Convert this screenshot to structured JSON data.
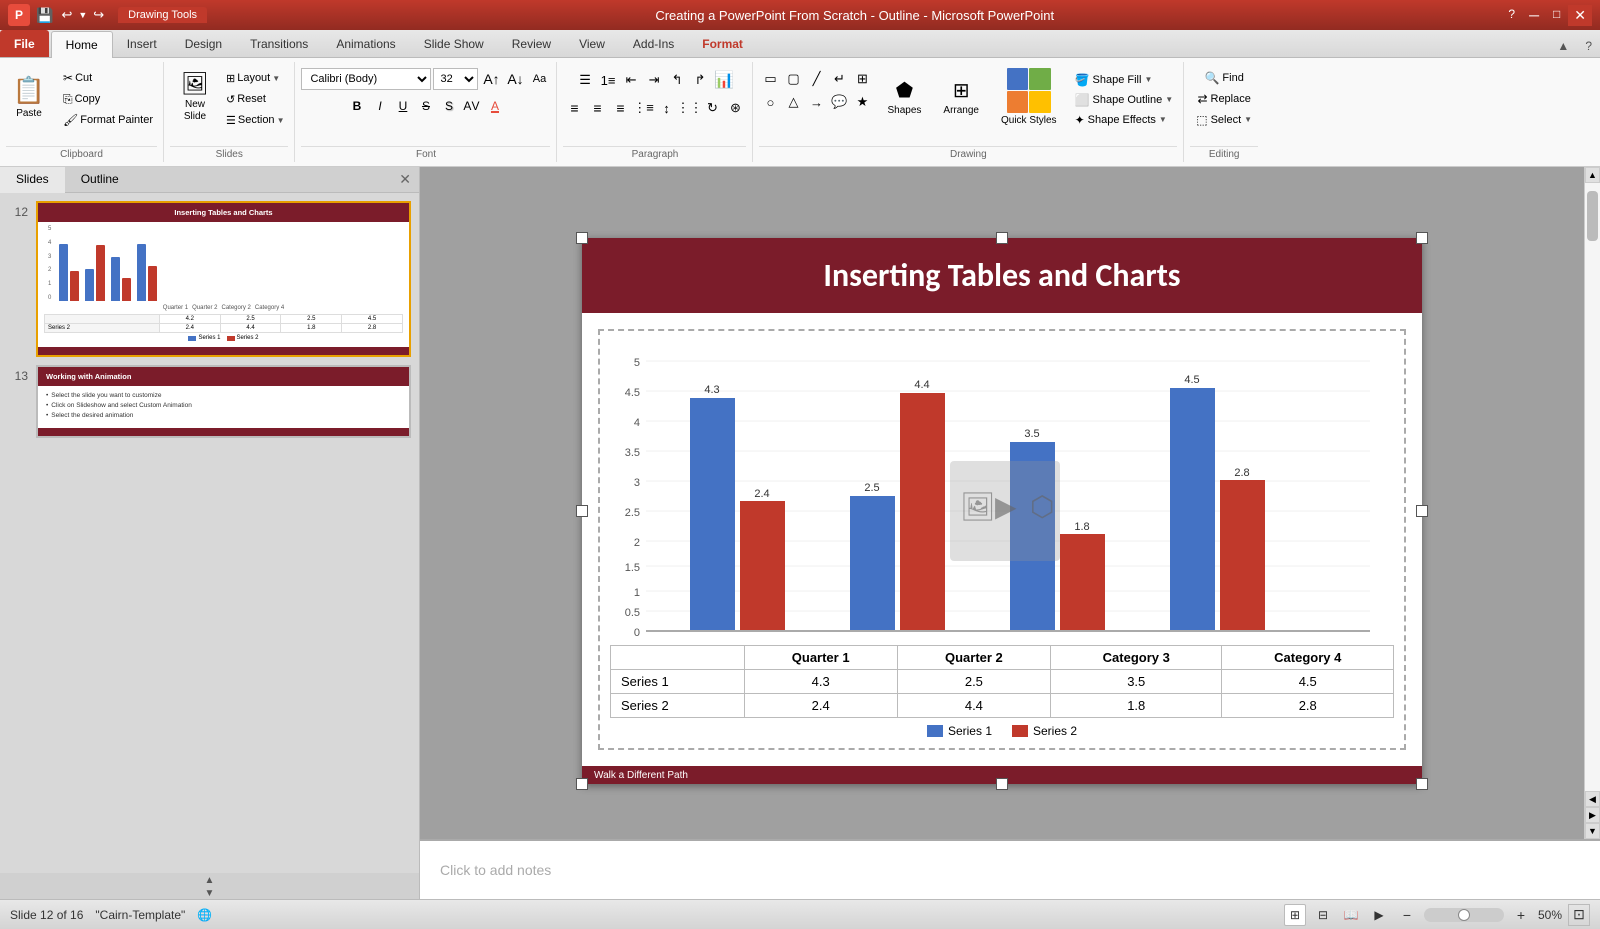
{
  "titleBar": {
    "appName": "P",
    "title": "Creating a PowerPoint From Scratch - Outline - Microsoft PowerPoint",
    "drawingTools": "Drawing Tools",
    "quickAccess": [
      "save",
      "undo",
      "redo"
    ]
  },
  "ribbon": {
    "tabs": [
      {
        "id": "file",
        "label": "File"
      },
      {
        "id": "home",
        "label": "Home",
        "active": true
      },
      {
        "id": "insert",
        "label": "Insert"
      },
      {
        "id": "design",
        "label": "Design"
      },
      {
        "id": "transitions",
        "label": "Transitions"
      },
      {
        "id": "animations",
        "label": "Animations"
      },
      {
        "id": "slideshow",
        "label": "Slide Show"
      },
      {
        "id": "review",
        "label": "Review"
      },
      {
        "id": "view",
        "label": "View"
      },
      {
        "id": "addins",
        "label": "Add-Ins"
      },
      {
        "id": "format",
        "label": "Format",
        "contextual": true
      }
    ],
    "groups": {
      "clipboard": {
        "label": "Clipboard",
        "paste": "Paste",
        "cut": "Cut",
        "copy": "Copy",
        "formatPainter": "Format Painter"
      },
      "slides": {
        "label": "Slides",
        "newSlide": "New Slide",
        "layout": "Layout",
        "reset": "Reset",
        "section": "Section"
      },
      "font": {
        "label": "Font",
        "fontFamily": "Calibri (Body)",
        "fontSize": "32",
        "bold": "B",
        "italic": "I",
        "underline": "U",
        "strikethrough": "S",
        "shadow": "S"
      },
      "paragraph": {
        "label": "Paragraph"
      },
      "drawing": {
        "label": "Drawing",
        "quickStyles": "Quick Styles",
        "shapeFill": "Shape Fill",
        "shapeOutline": "Shape Outline",
        "shapeEffects": "Shape Effects"
      },
      "editing": {
        "label": "Editing",
        "find": "Find",
        "replace": "Replace",
        "select": "Select"
      }
    }
  },
  "panelTabs": [
    "Slides",
    "Outline"
  ],
  "slides": [
    {
      "num": 12,
      "title": "Inserting Tables and Charts",
      "selected": true
    },
    {
      "num": 13,
      "title": "Working with Animation",
      "bullets": [
        "Select the slide you want to customize",
        "Click on Slideshow and select Custom Animation",
        "Select the desired animation"
      ]
    }
  ],
  "mainSlide": {
    "title": "Inserting Tables and Charts",
    "chart": {
      "categories": [
        "Quarter 1",
        "Quarter 2",
        "Category 3",
        "Category 4"
      ],
      "series1Label": "Series 1",
      "series2Label": "Series 2",
      "series1Values": [
        4.3,
        2.5,
        3.5,
        4.5
      ],
      "series2Values": [
        2.4,
        4.4,
        1.8,
        2.8
      ],
      "yAxisValues": [
        "5",
        "4.5",
        "4",
        "3.5",
        "3",
        "2.5",
        "2",
        "1.5",
        "1",
        "0.5",
        "0"
      ],
      "labels": {
        "s1q1": "4.3",
        "s2q1": "2.4",
        "s1q2": "2.5",
        "s2q2": "4.4",
        "s1q3": "3.5",
        "s2q3": "1.8",
        "s1q4": "4.5",
        "s2q4": "2.8"
      }
    },
    "footer": "Walk a Different Path"
  },
  "notesPlaceholder": "Click to add notes",
  "statusBar": {
    "slideInfo": "Slide 12 of 16",
    "theme": "\"Cairn-Template\"",
    "zoom": "50%"
  }
}
